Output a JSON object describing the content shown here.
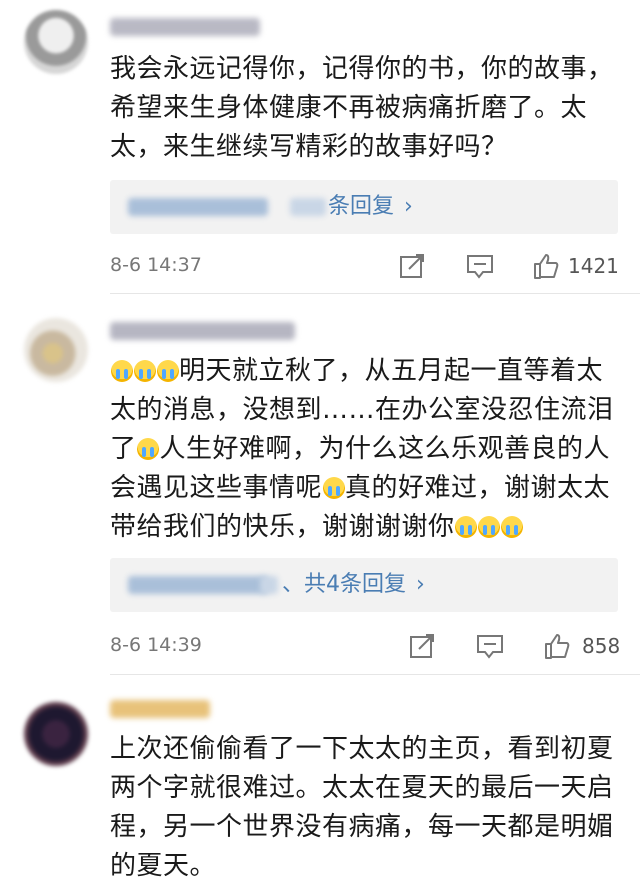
{
  "comments": [
    {
      "text": "我会永远记得你，记得你的书，你的故事，\n希望来生身体健康不再被病痛折磨了。太\n太，来生继续写精彩的故事好吗？",
      "reply_label": "条回复",
      "reply_chevron": "›",
      "date": "8-6 14:37",
      "likes": "1421"
    },
    {
      "line1": "明天就立秋了，从五月起一直等着太",
      "line2": "太的消息，没想到……在办公室没忍住流泪",
      "line3a": "了",
      "line3b": "人生好难啊，为什么这么乐观善良的人",
      "line4a": "会遇见这些事情呢",
      "line4b": "真的好难过，谢谢太太",
      "line5": "带给我们的快乐，谢谢谢谢你",
      "emoji_name": "crying-emoji",
      "reply_label": "、共4条回复",
      "reply_chevron": "›",
      "date": "8-6 14:39",
      "likes": "858"
    },
    {
      "text": "上次还偷偷看了一下太太的主页，看到初夏\n两个字就很难过。太太在夏天的最后一天启\n程，另一个世界没有病痛，每一天都是明媚\n的夏天。"
    }
  ],
  "icons": {
    "share": "share-icon",
    "comment": "comment-icon",
    "like": "thumbs-up-icon"
  },
  "colors": {
    "link": "#4a7db3",
    "meta": "#777777",
    "reply_bg": "#f2f2f2"
  }
}
